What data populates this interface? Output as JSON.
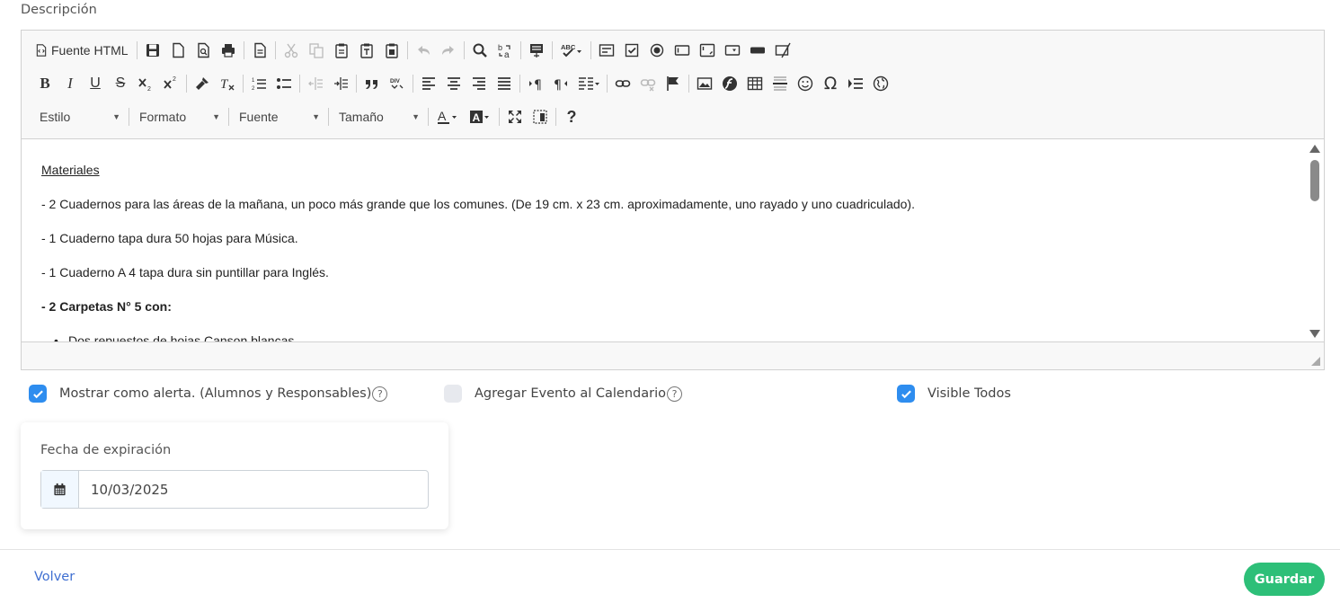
{
  "field_label": "Descripción",
  "toolbar": {
    "source_label": "Fuente HTML",
    "style_combo": "Estilo",
    "format_combo": "Formato",
    "font_combo": "Fuente",
    "size_combo": "Tamaño",
    "help_label": "?"
  },
  "content": {
    "heading": "Materiales",
    "line1": "- 2 Cuadernos para las áreas de la mañana,  un poco más grande que los comunes. (De 19 cm. x 23 cm. aproximadamente, uno rayado y uno cuadriculado).",
    "line2": "- 1 Cuaderno tapa dura 50 hojas para Música.",
    "line3": "- 1 Cuaderno A 4 tapa dura sin puntillar para Inglés.",
    "line4": "- 2 Carpetas N° 5 con:",
    "line5": "Dos repuestos de hojas Canson blancas."
  },
  "options": {
    "alert_label": "Mostrar como alerta. (Alumnos y Responsables)",
    "alert_checked": true,
    "calendar_label": "Agregar Evento al Calendario",
    "calendar_checked": false,
    "visible_label": "Visible Todos",
    "visible_checked": true,
    "help_glyph": "?"
  },
  "expiration": {
    "label": "Fecha de expiración",
    "value": "10/03/2025"
  },
  "footer": {
    "back_label": "Volver",
    "save_label": "Guardar"
  },
  "colors": {
    "accent_blue": "#2e8def",
    "save_green": "#2dbf78",
    "link_blue": "#3f6fd1"
  }
}
